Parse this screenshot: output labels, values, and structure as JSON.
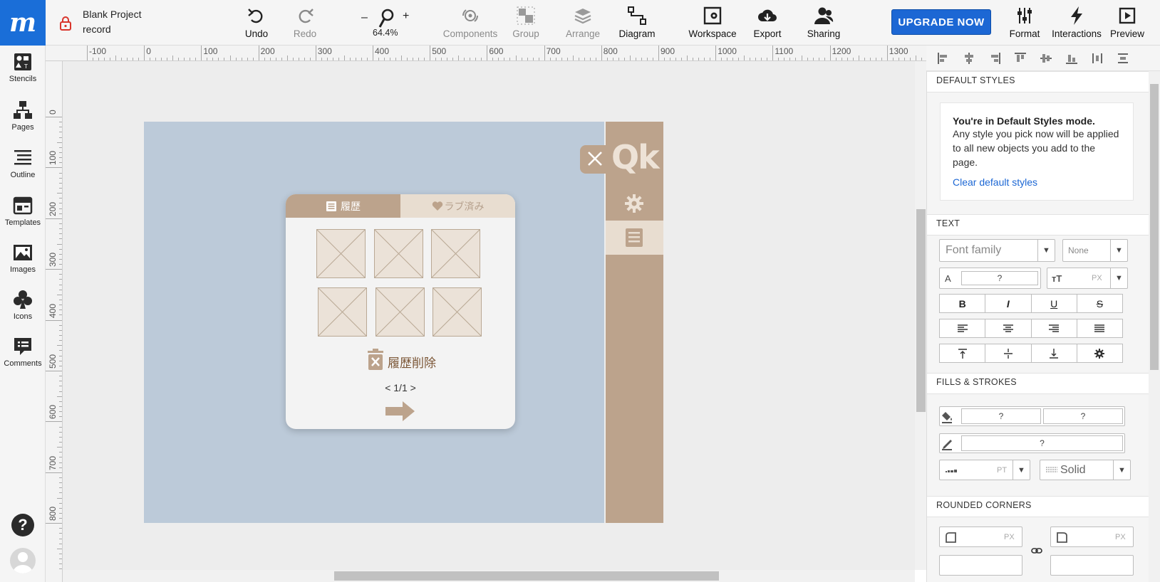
{
  "topbar": {
    "project_name": "Blank Project",
    "page_name": "record",
    "zoom": "64.4%",
    "zoom_minus": "–",
    "zoom_plus": "+",
    "upgrade_label": "UPGRADE NOW",
    "buttons": {
      "undo": "Undo",
      "redo": "Redo",
      "components": "Components",
      "group": "Group",
      "arrange": "Arrange",
      "diagram": "Diagram",
      "workspace": "Workspace",
      "export": "Export",
      "sharing": "Sharing",
      "format": "Format",
      "interactions": "Interactions",
      "preview": "Preview"
    }
  },
  "sidebar": {
    "items": [
      {
        "label": "Stencils",
        "icon": "stencils-icon"
      },
      {
        "label": "Pages",
        "icon": "pages-icon"
      },
      {
        "label": "Outline",
        "icon": "outline-icon"
      },
      {
        "label": "Templates",
        "icon": "templates-icon"
      },
      {
        "label": "Images",
        "icon": "images-icon"
      },
      {
        "label": "Icons",
        "icon": "club-icon"
      },
      {
        "label": "Comments",
        "icon": "comments-icon"
      }
    ],
    "help": "?"
  },
  "rulers": {
    "h_labels": [
      "-100",
      "0",
      "100",
      "200",
      "300",
      "400",
      "500",
      "600",
      "700",
      "800",
      "900",
      "1000",
      "1100",
      "1200",
      "1300"
    ],
    "v_labels": [
      "0",
      "100",
      "200",
      "300",
      "400",
      "500",
      "600",
      "700",
      "800"
    ]
  },
  "design": {
    "side_logo": "Qk",
    "tab_history": "履歴",
    "tab_liked": "ラブ済み",
    "delete_history": "履歴削除",
    "pager": "< 1/1 >",
    "colors": {
      "board": "#bccad9",
      "panel": "#bca38c",
      "light": "#e8ddd0"
    }
  },
  "props": {
    "default_styles": {
      "header": "DEFAULT STYLES",
      "title": "You're in Default Styles mode.",
      "body": "Any style you pick now will be applied to all new objects you add to the page.",
      "link": "Clear default styles"
    },
    "text": {
      "header": "TEXT",
      "font_family_placeholder": "Font family",
      "font_weight": "None",
      "color_label": "A",
      "color_value": "?",
      "size_unit": "PX",
      "style_buttons": [
        "B",
        "I",
        "U",
        "S"
      ]
    },
    "fills": {
      "header": "FILLS & STROKES",
      "fill1": "?",
      "fill2": "?",
      "stroke": "?",
      "stroke_unit": "PT",
      "stroke_style": "Solid"
    },
    "corners": {
      "header": "ROUNDED CORNERS",
      "unit1": "PX",
      "unit2": "PX"
    }
  }
}
